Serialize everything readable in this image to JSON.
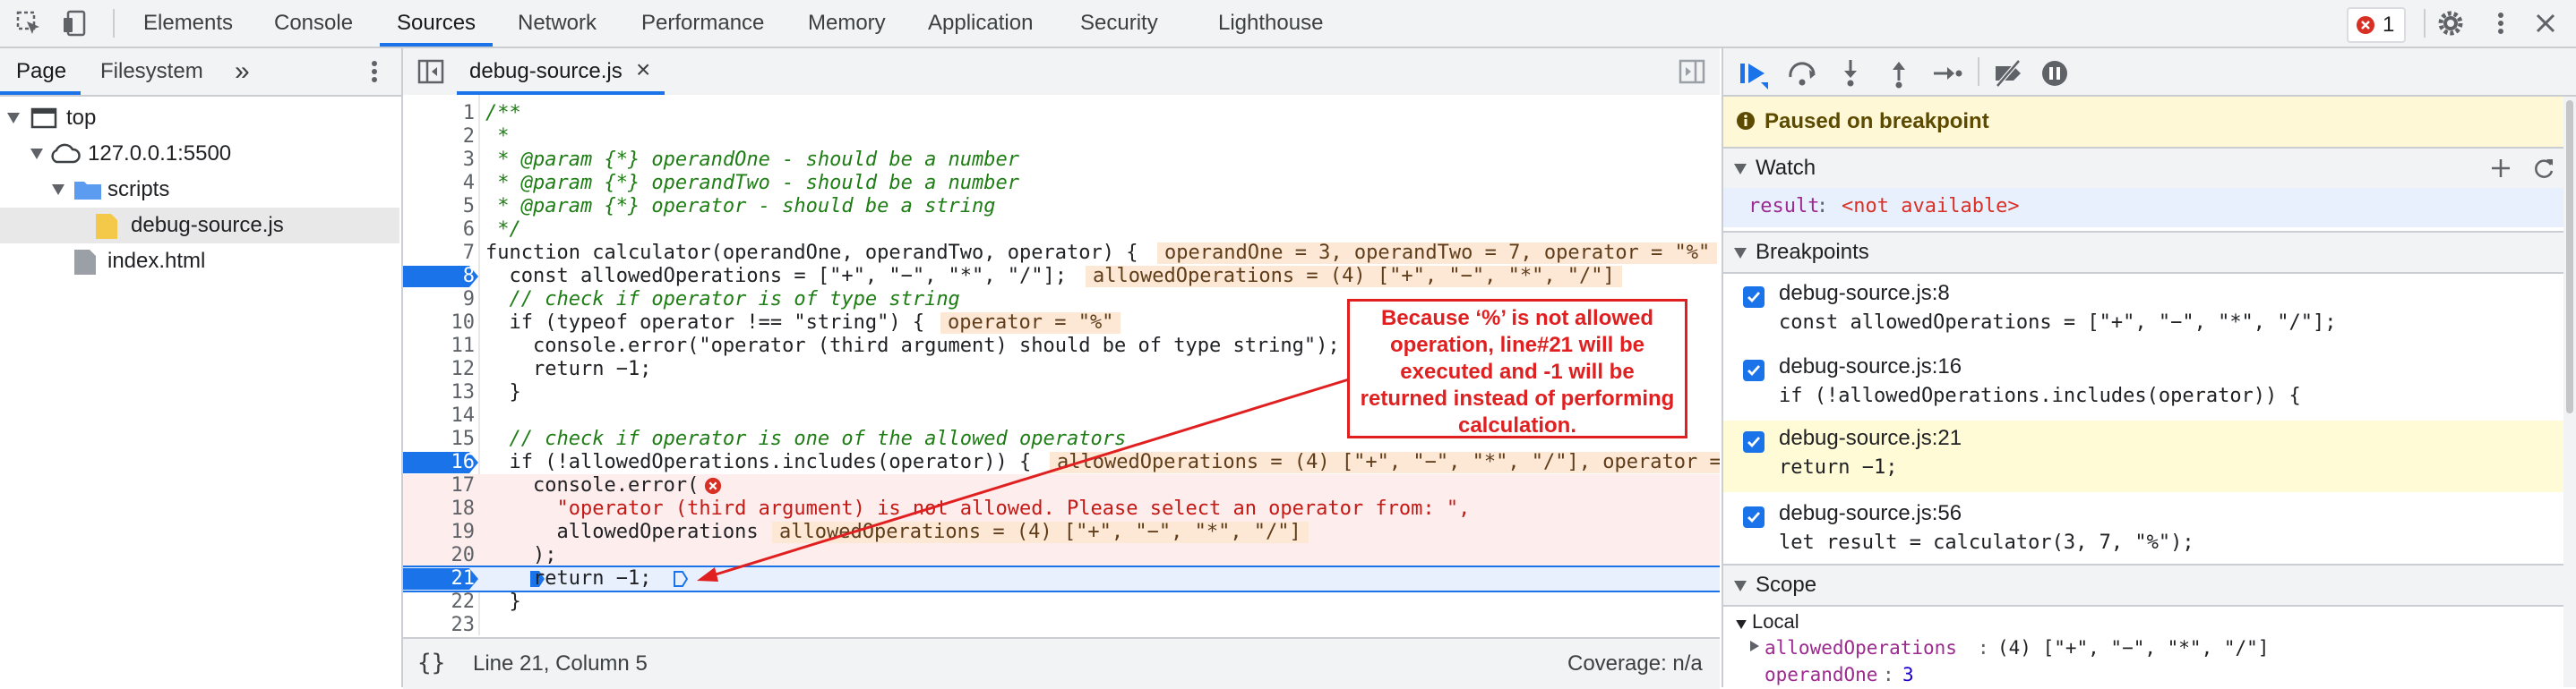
{
  "toolbar": {
    "tabs": [
      "Elements",
      "Console",
      "Sources",
      "Network",
      "Performance",
      "Memory",
      "Application",
      "Security",
      "Lighthouse"
    ],
    "active_tab": "Sources",
    "error_count": "1",
    "icons": [
      "inspect-element-icon",
      "device-toolbar-icon",
      "error-icon",
      "settings-gear-icon",
      "more-vert-icon",
      "close-icon"
    ]
  },
  "navigator": {
    "tabs": [
      "Page",
      "Filesystem"
    ],
    "more": "»",
    "tree": [
      {
        "label": "top",
        "icon": "frame-icon"
      },
      {
        "label": "127.0.0.1:5500",
        "icon": "cloud-icon"
      },
      {
        "label": "scripts",
        "icon": "folder-icon"
      },
      {
        "label": "debug-source.js",
        "icon": "js-file-icon"
      },
      {
        "label": "index.html",
        "icon": "file-icon"
      }
    ]
  },
  "editor": {
    "tab_label": "debug-source.js",
    "close_glyph": "×",
    "lines": [
      {
        "n": "1",
        "text": "/**"
      },
      {
        "n": "2",
        "text": " *"
      },
      {
        "n": "3",
        "text": " * @param {*} operandOne - should be a number"
      },
      {
        "n": "4",
        "text": " * @param {*} operandTwo - should be a number"
      },
      {
        "n": "5",
        "text": " * @param {*} operator - should be a string"
      },
      {
        "n": "6",
        "text": " */"
      },
      {
        "n": "7",
        "text": "function calculator(operandOne, operandTwo, operator) {"
      },
      {
        "n": "8",
        "text": "  const allowedOperations = [\"+\", \"−\", \"*\", \"/\"];"
      },
      {
        "n": "9",
        "text": "  // check if operator is of type string"
      },
      {
        "n": "10",
        "text": "  if (typeof operator !== \"string\") {"
      },
      {
        "n": "11",
        "text": "    console.error(\"operator (third argument) should be of type string\");"
      },
      {
        "n": "12",
        "text": "    return −1;"
      },
      {
        "n": "13",
        "text": "  }"
      },
      {
        "n": "14",
        "text": ""
      },
      {
        "n": "15",
        "text": "  // check if operator is one of the allowed operators"
      },
      {
        "n": "16",
        "text": "  if (!allowedOperations.includes(operator)) {"
      },
      {
        "n": "17",
        "text": "    console.error("
      },
      {
        "n": "18",
        "text": "      \"operator (third argument) is not allowed. Please select an operator from: \","
      },
      {
        "n": "19",
        "text": "      allowedOperations"
      },
      {
        "n": "20",
        "text": "    );"
      },
      {
        "n": "21",
        "text": "    return −1;"
      },
      {
        "n": "22",
        "text": "  }"
      },
      {
        "n": "23",
        "text": ""
      }
    ],
    "inline_values": {
      "l7": "operandOne = 3, operandTwo = 7, operator = \"%\"",
      "l8": "allowedOperations = (4) [\"+\", \"−\", \"*\", \"/\"]",
      "l10": "operator = \"%\"",
      "l16": "allowedOperations = (4) [\"+\", \"−\", \"*\", \"/\"], operator =",
      "l19": "allowedOperations = (4) [\"+\", \"−\", \"*\", \"/\"]"
    },
    "breakpoint_lines": [
      "8",
      "16",
      "21"
    ],
    "paused_line": "21"
  },
  "annotation": {
    "text": "Because ‘%’ is not allowed operation, line#21 will be executed and -1 will be returned instead of performing calculation."
  },
  "statusbar": {
    "format_glyph": "{}",
    "position": "Line 21, Column 5",
    "coverage": "Coverage: n/a"
  },
  "debugger": {
    "paused_text": "Paused on breakpoint",
    "watch_label": "Watch",
    "watch_expr": "result",
    "watch_value": "<not available>",
    "breakpoints_label": "Breakpoints",
    "breakpoints": [
      {
        "loc": "debug-source.js:8",
        "code": "const allowedOperations = [\"+\", \"−\", \"*\", \"/\"];"
      },
      {
        "loc": "debug-source.js:16",
        "code": "if (!allowedOperations.includes(operator)) {"
      },
      {
        "loc": "debug-source.js:21",
        "code": "return −1;"
      },
      {
        "loc": "debug-source.js:56",
        "code": "let result = calculator(3, 7, \"%\");"
      }
    ],
    "scope_label": "Scope",
    "local_label": "Local",
    "scope_vars": [
      {
        "name": "allowedOperations",
        "value": "(4) [\"+\", \"−\", \"*\", \"/\"]"
      },
      {
        "name": "operandOne",
        "value": "3"
      }
    ],
    "colors": {
      "accent": "#1a73e8",
      "paused_bg": "#fff8d6",
      "inline_bg": "#fce8d5",
      "annotation": "#e02020"
    }
  }
}
